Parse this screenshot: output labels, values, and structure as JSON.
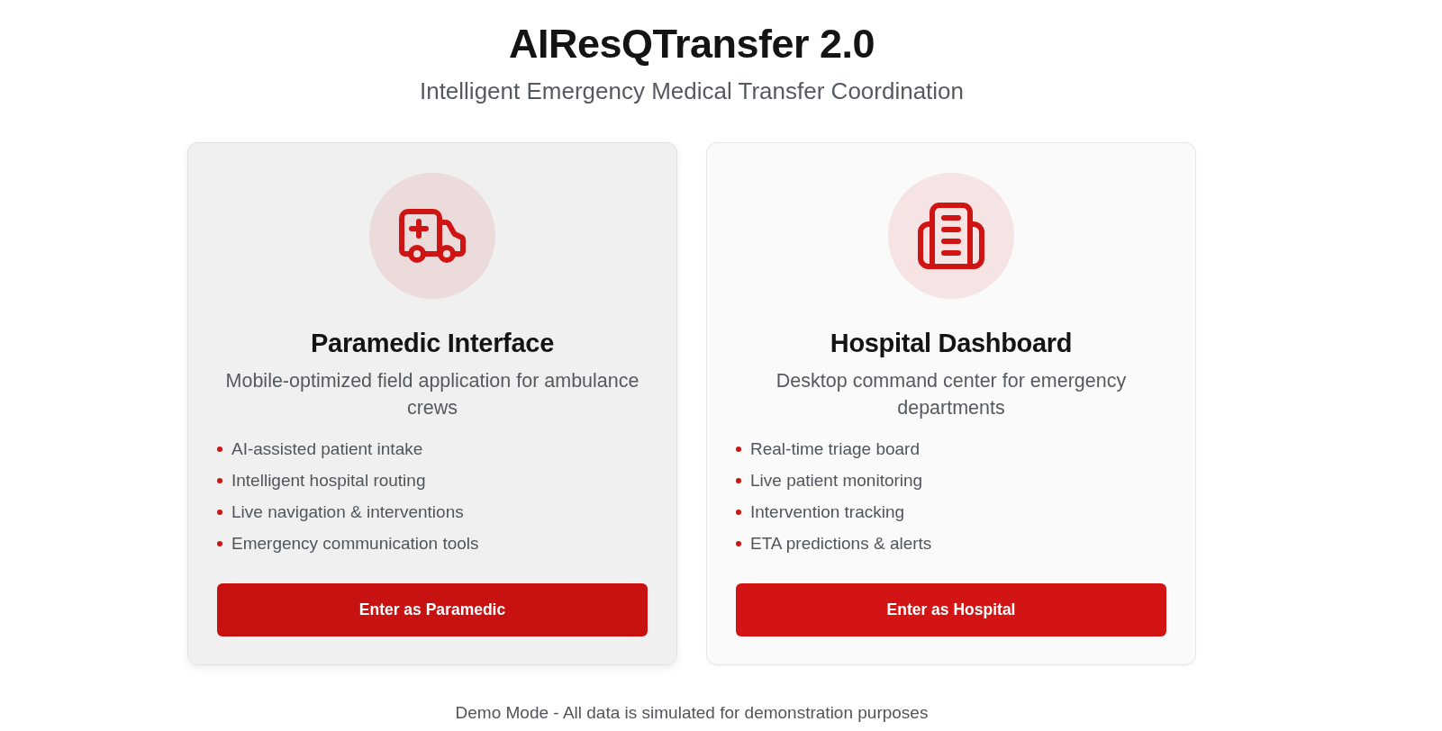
{
  "header": {
    "title": "AIResQTransfer 2.0",
    "subtitle": "Intelligent Emergency Medical Transfer Coordination"
  },
  "cards": [
    {
      "kind": "ambulance",
      "hovered": true,
      "title": "Paramedic Interface",
      "description": "Mobile-optimized field application for ambulance crews",
      "features": [
        "AI-assisted patient intake",
        "Intelligent hospital routing",
        "Live navigation & interventions",
        "Emergency communication tools"
      ],
      "button": "Enter as Paramedic"
    },
    {
      "kind": "hospital",
      "hovered": false,
      "title": "Hospital Dashboard",
      "description": "Desktop command center for emergency departments",
      "features": [
        "Real-time triage board",
        "Live patient monitoring",
        "Intervention tracking",
        "ETA predictions & alerts"
      ],
      "button": "Enter as Hospital"
    }
  ],
  "footer": "Demo Mode - All data is simulated for demonstration purposes"
}
